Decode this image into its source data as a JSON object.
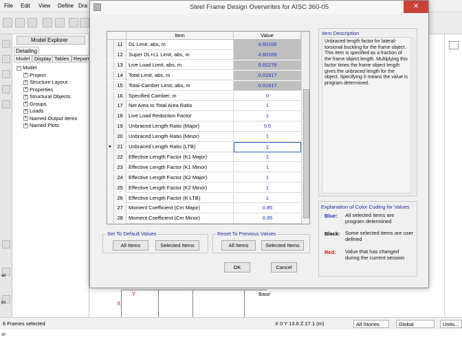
{
  "app": {
    "menu": [
      "File",
      "Edit",
      "View",
      "Define",
      "Dra"
    ],
    "explorer_title": "Model Explorer",
    "explorer_detailing": "Detailing",
    "explorer_tabs": [
      "Model",
      "Display",
      "Tables",
      "Report"
    ],
    "tree": [
      {
        "label": "Model",
        "level": 0
      },
      {
        "label": "Project",
        "level": 1
      },
      {
        "label": "Structure Layout",
        "level": 1
      },
      {
        "label": "Properties",
        "level": 1
      },
      {
        "label": "Structural Objects",
        "level": 1
      },
      {
        "label": "Groups",
        "level": 1
      },
      {
        "label": "Loads",
        "level": 1
      },
      {
        "label": "Named Output Items",
        "level": 1
      },
      {
        "label": "Named Plots",
        "level": 1
      }
    ],
    "canvas_base_label": "Base",
    "axis_labels": [
      "Y",
      "X"
    ],
    "left_strip_labels": [
      "all",
      "ps",
      "clr"
    ]
  },
  "dialog": {
    "title": "Steel Frame Design Overwrites for AISC 360-05",
    "grid": {
      "headers": {
        "item": "Item",
        "value": "Value"
      },
      "rows": [
        {
          "num": "11",
          "item": "DL Limit, abs, m",
          "value": "4.60109",
          "gray": true
        },
        {
          "num": "12",
          "item": "Super DL+LL Limit, abs, m",
          "value": "4.60109",
          "gray": true
        },
        {
          "num": "13",
          "item": "Live Load Limit, abs, m",
          "value": "0.01278",
          "gray": true
        },
        {
          "num": "14",
          "item": "Total Limit, abs, m",
          "value": "0.01917",
          "gray": true
        },
        {
          "num": "15",
          "item": "Total-Camber Limit, abs, m",
          "value": "0.01917",
          "gray": true
        },
        {
          "num": "16",
          "item": "Specified Camber, m",
          "value": "0",
          "gray": false
        },
        {
          "num": "17",
          "item": "Net Area to Total Area Ratio",
          "value": "1",
          "gray": false
        },
        {
          "num": "18",
          "item": "Live Load Reduction Factor",
          "value": "1",
          "gray": false
        },
        {
          "num": "19",
          "item": "Unbraced Length Ratio (Major)",
          "value": "0.5",
          "gray": false
        },
        {
          "num": "20",
          "item": "Unbraced Length Ratio (Minor)",
          "value": "1",
          "gray": false
        },
        {
          "num": "21",
          "item": "Unbraced Length Ratio (LTB)",
          "value": "1",
          "gray": false,
          "active": true
        },
        {
          "num": "22",
          "item": "Effective Length Factor (K1 Major)",
          "value": "1",
          "gray": false
        },
        {
          "num": "23",
          "item": "Effective Length Factor (K1 Minor)",
          "value": "1",
          "gray": false
        },
        {
          "num": "24",
          "item": "Effective Length Factor (K2 Major)",
          "value": "1",
          "gray": false
        },
        {
          "num": "25",
          "item": "Effective Length Factor (K2 Minor)",
          "value": "1",
          "gray": false
        },
        {
          "num": "26",
          "item": "Effective Length Factor (K LTB)",
          "value": "1",
          "gray": false
        },
        {
          "num": "27",
          "item": "Moment Coefficient (Cm Major)",
          "value": "0.85",
          "gray": false
        },
        {
          "num": "28",
          "item": "Moment Coefficient (Cm Minor)",
          "value": "0.85",
          "gray": false
        }
      ]
    },
    "item_description": {
      "label": "Item Description",
      "text": "Unbraced length factor for lateral-torsional buckling for the frame object. This item is specified as a fraction of the frame object length.  Multiplying this factor times the frame object length gives the unbraced length for the object.  Specifying 0 means the value is program determined."
    },
    "color_coding": {
      "title": "Explanation of Color Coding for Values",
      "items": [
        {
          "key": "Blue:",
          "color": "#1a2fc9",
          "text": "All selected items are program determined"
        },
        {
          "key": "Black:",
          "color": "#000000",
          "text": "Some selected items are user defined"
        },
        {
          "key": "Red:",
          "color": "#d01010",
          "text": "Value that has changed during the current session"
        }
      ]
    },
    "set_default": {
      "label": "Set To Default Values",
      "all_items": "All Items",
      "selected_items": "Selected Items"
    },
    "reset_previous": {
      "label": "Reset To Previous Values",
      "all_items": "All Items",
      "selected_items": "Selected Items"
    },
    "ok": "OK",
    "cancel": "Cancel",
    "close_glyph": "✕"
  },
  "status": {
    "left": "6 Frames selected",
    "coords": "X 0  Y 13.6  Z 27.1 (m)",
    "stories": "All Stories",
    "coord_system": "Global",
    "units": "Units..."
  }
}
